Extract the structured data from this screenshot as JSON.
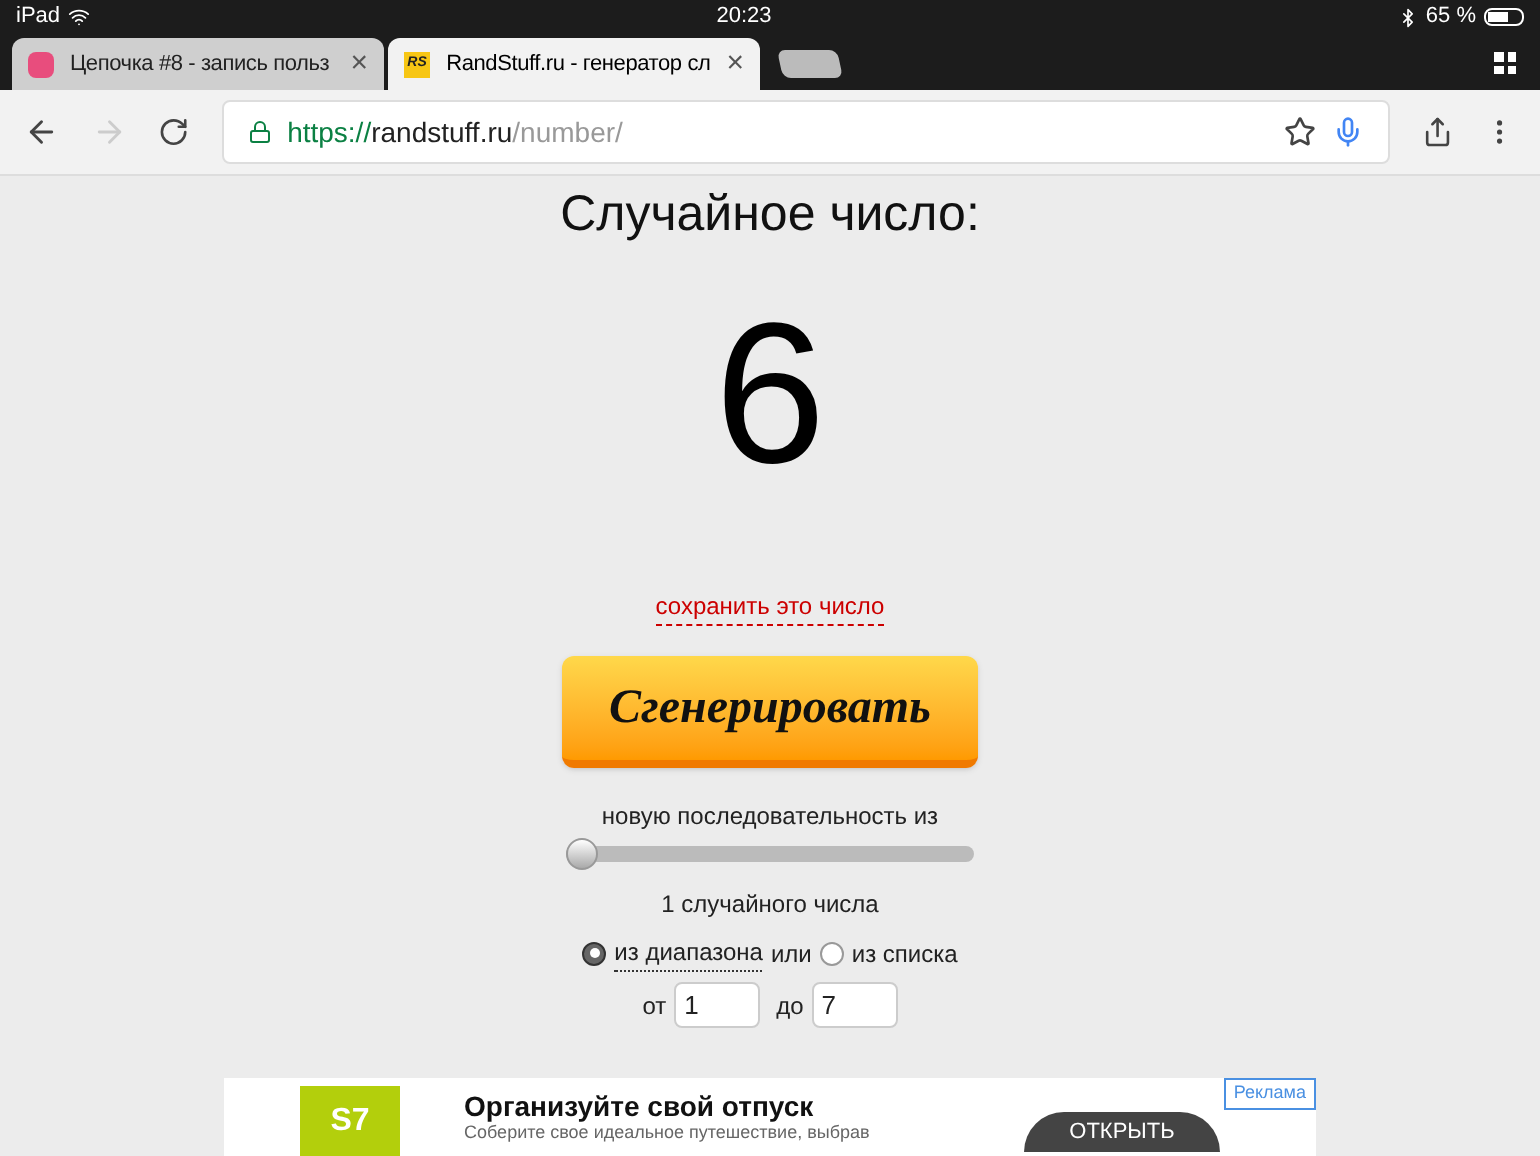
{
  "status_bar": {
    "device": "iPad",
    "time": "20:23",
    "battery": "65 %"
  },
  "tabs": [
    {
      "title": "Цепочка #8 - запись польз",
      "close": "×",
      "selected": false,
      "kind": "chain"
    },
    {
      "title": "RandStuff.ru - генератор сл",
      "close": "×",
      "selected": true,
      "kind": "randstuff"
    }
  ],
  "favicon_text": "RS",
  "address_bar": {
    "scheme": "https://",
    "host": "randstuff.ru",
    "path": "/number/"
  },
  "page": {
    "heading": "Случайное число:",
    "number": "6",
    "save_link": "сохранить это число",
    "generate_button": "Сгенерировать",
    "sequence_label": "новую последовательность из",
    "slider": {
      "level": 0
    },
    "count_label": "1 случайного числа",
    "sources": [
      {
        "label": "из диапазона",
        "selected": true
      },
      {
        "label": "из списка",
        "selected": false
      }
    ],
    "or_text": "или",
    "from_label": "от",
    "from_value": "1",
    "to_label": "до",
    "to_value": "7"
  },
  "ad": {
    "badge": "Реклама",
    "logo": "S7",
    "title": "Организуйте свой отпуск",
    "text": "Соберите свое идеальное путешествие, выбрав",
    "button": "ОТКРЫТЬ"
  }
}
